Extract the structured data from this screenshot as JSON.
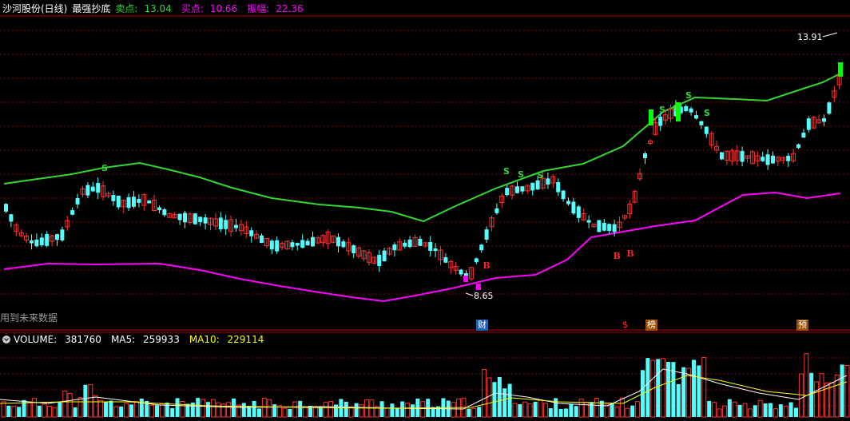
{
  "header": {
    "stock_name": "沙河股份(日线)",
    "indicator_name": "最强抄底",
    "sell_label": "卖点:",
    "sell_value": "13.04",
    "buy_label": "买点:",
    "buy_value": "10.66",
    "amp_label": "振幅:",
    "amp_value": "22.36"
  },
  "chart": {
    "high_marker": "13.91",
    "low_marker": "8.65",
    "future_warning": "用到未来数据",
    "sell_signal": "S",
    "buy_signal": "B",
    "events": [
      "财",
      "$",
      "榜",
      "预"
    ]
  },
  "volume": {
    "label": "VOLUME:",
    "value": "381760",
    "ma5_label": "MA5:",
    "ma5_value": "259933",
    "ma10_label": "MA10:",
    "ma10_value": "229114"
  },
  "colors": {
    "up": "#ff3232",
    "down": "#54ffff",
    "upper_band": "#32d732",
    "lower_band": "#ff00ff",
    "grid": "#8b0000",
    "ma5": "#ffffff",
    "ma10": "#ffff00"
  }
}
